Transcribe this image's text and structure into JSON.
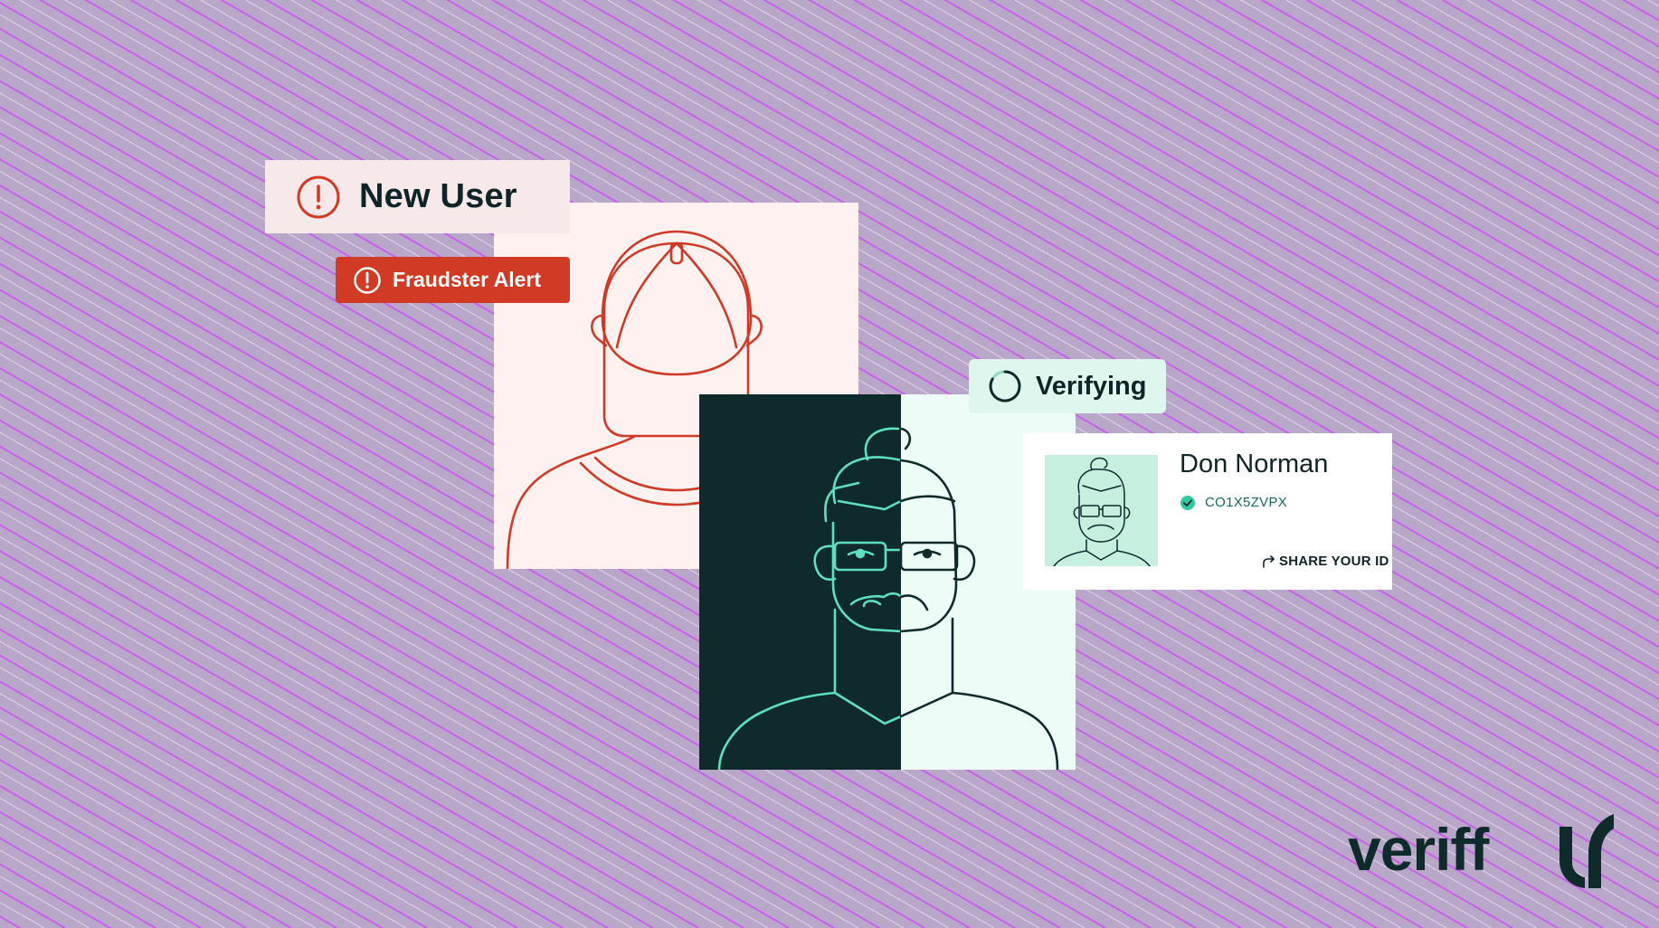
{
  "new_user_card": {
    "title": "New User",
    "icon": "alert-circle-icon",
    "accent_color": "#d13a24"
  },
  "fraud_alert": {
    "label": "Fraudster Alert",
    "icon": "alert-circle-icon",
    "background_color": "#d13a24"
  },
  "verifying_badge": {
    "label": "Verifying",
    "icon": "spinner-icon"
  },
  "id_card": {
    "name": "Don Norman",
    "code": "CO1X5ZVPX",
    "share_label": "SHARE YOUR ID",
    "status_icon": "verified-check-icon",
    "share_icon": "share-arrow-icon"
  },
  "brand": {
    "wordmark": "veriff",
    "mark_icon": "veriff-v-logo-icon",
    "primary_color": "#0f2a2b",
    "accent_color": "#2fc9a0"
  },
  "colors": {
    "background": "#b8a7c8",
    "stripe": "#c95ceb",
    "fraud_panel": "#fff1ef",
    "verified_dark": "#0f2a2b",
    "verified_light": "#eefcf8"
  }
}
